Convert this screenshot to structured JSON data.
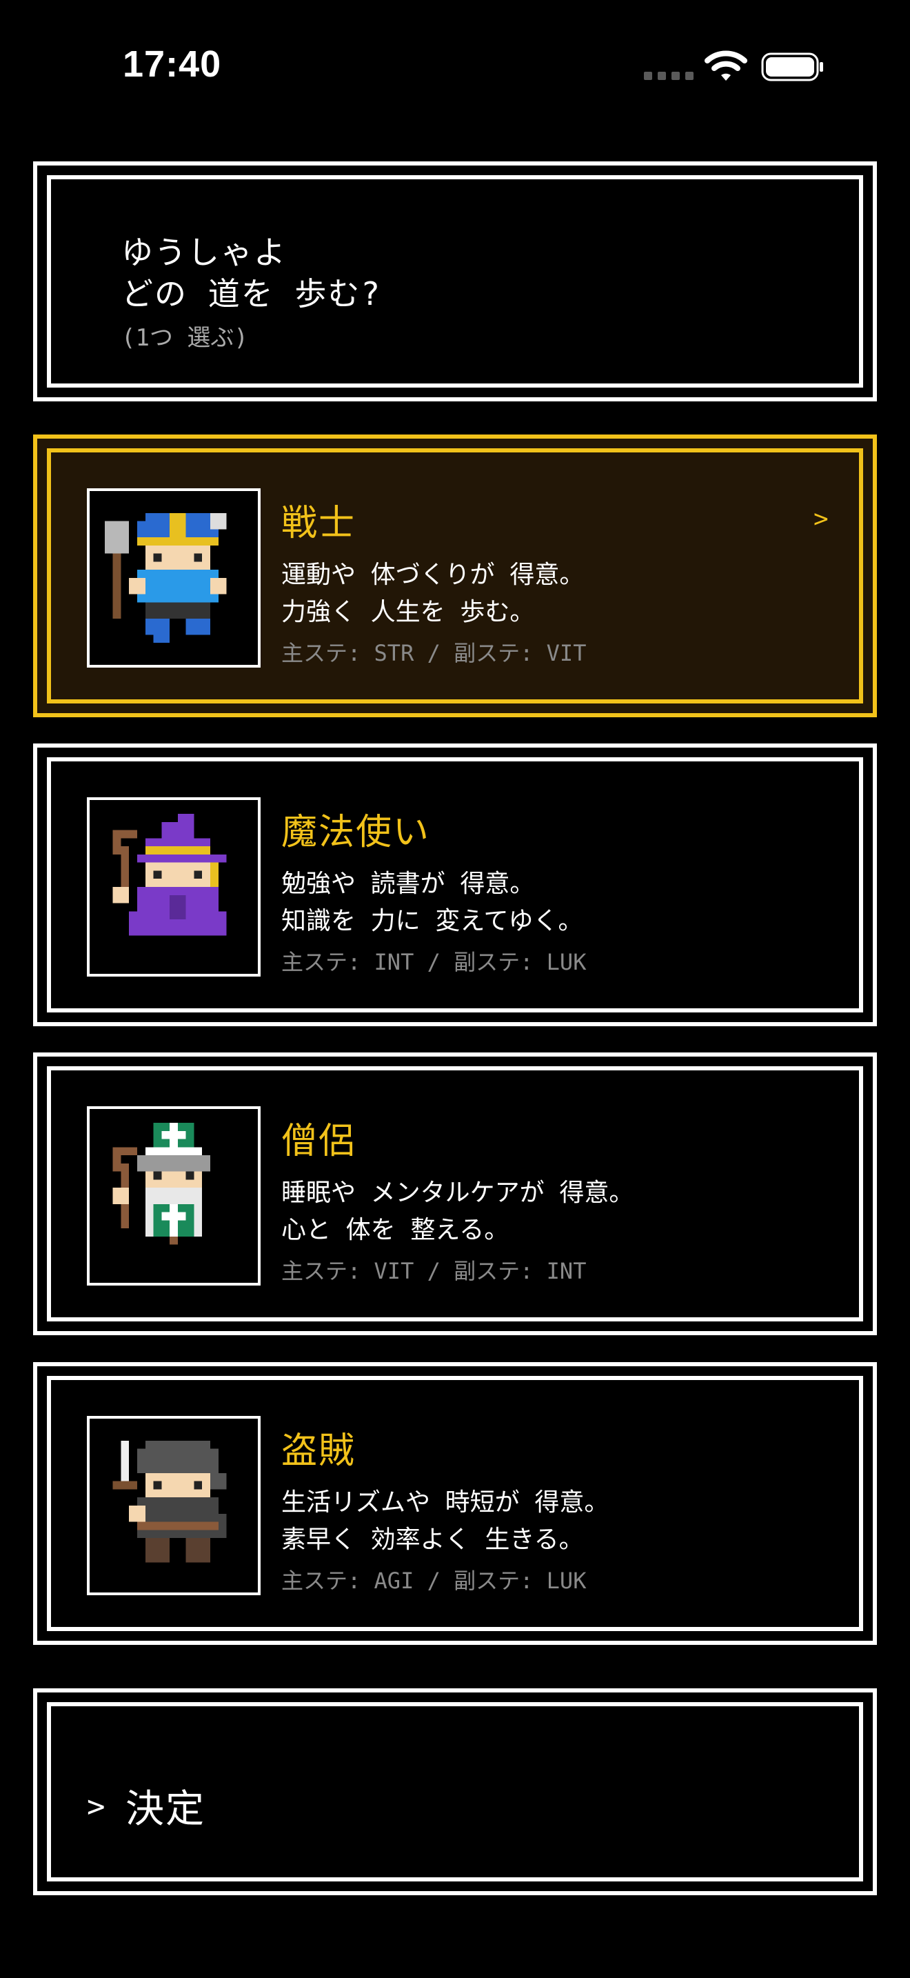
{
  "status_bar": {
    "time": "17:40"
  },
  "prompt": {
    "line1": "ゆうしゃよ",
    "line2": "どの 道を 歩む?",
    "note": "(1つ 選ぶ)"
  },
  "classes": [
    {
      "name": "戦士",
      "desc1": "運動や 体づくりが 得意。",
      "desc2": "力強く 人生を 歩む。",
      "stats": "主ステ: STR / 副ステ: VIT",
      "selected": true,
      "chevron": ">"
    },
    {
      "name": "魔法使い",
      "desc1": "勉強や 読書が 得意。",
      "desc2": "知識を 力に 変えてゆく。",
      "stats": "主ステ: INT / 副ステ: LUK",
      "selected": false
    },
    {
      "name": "僧侶",
      "desc1": "睡眠や メンタルケアが 得意。",
      "desc2": "心と 体を 整える。",
      "stats": "主ステ: VIT / 副ステ: INT",
      "selected": false
    },
    {
      "name": "盗賊",
      "desc1": "生活リズムや 時短が 得意。",
      "desc2": "素早く 効率よく 生きる。",
      "stats": "主ステ: AGI / 副ステ: LUK",
      "selected": false
    }
  ],
  "confirm": {
    "caret": ">",
    "label": "決定"
  },
  "colors": {
    "accent": "#f2c21a",
    "selected_bg": "#221606",
    "frame": "#ffffff",
    "muted": "#8a8a8a"
  },
  "icons": {
    "warrior": "warrior-sprite-icon",
    "mage": "mage-sprite-icon",
    "priest": "priest-sprite-icon",
    "thief": "thief-sprite-icon"
  }
}
